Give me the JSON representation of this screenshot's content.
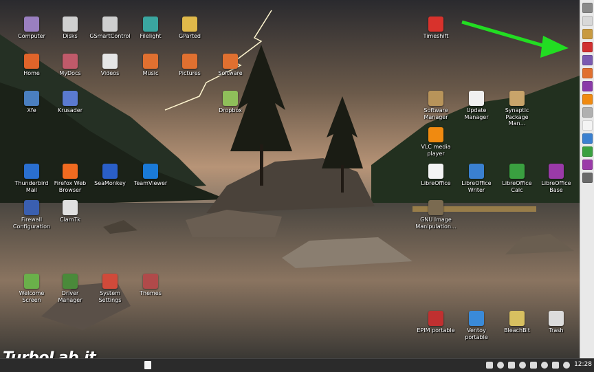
{
  "desktop_icons": [
    {
      "label": "Computer",
      "icon": "computer-icon",
      "color": "#9a7fc0"
    },
    {
      "label": "Disks",
      "icon": "disks-icon",
      "color": "#d0d0d0"
    },
    {
      "label": "GSmartControl",
      "icon": "gsmartcontrol-icon",
      "color": "#cfcfcf"
    },
    {
      "label": "Filelight",
      "icon": "filelight-icon",
      "color": "#3aa6a0"
    },
    {
      "label": "GParted",
      "icon": "gparted-icon",
      "color": "#e0b94a"
    },
    {
      "label": "Timeshift",
      "icon": "timeshift-icon",
      "color": "#d8322c"
    },
    {
      "label": "Home",
      "icon": "home-folder-icon",
      "color": "#e0642a"
    },
    {
      "label": "MyDocs",
      "icon": "mydocs-folder-icon",
      "color": "#c05a6a"
    },
    {
      "label": "Videos",
      "icon": "videos-folder-icon",
      "color": "#e6e6e6"
    },
    {
      "label": "Music",
      "icon": "music-folder-icon",
      "color": "#e07030"
    },
    {
      "label": "Pictures",
      "icon": "pictures-folder-icon",
      "color": "#e07030"
    },
    {
      "label": "Software",
      "icon": "software-folder-icon",
      "color": "#e07030"
    },
    {
      "label": "Xfe",
      "icon": "xfe-icon",
      "color": "#4a7fc0"
    },
    {
      "label": "Krusader",
      "icon": "krusader-icon",
      "color": "#5a7ad0"
    },
    {
      "label": "Dropbox",
      "icon": "dropbox-folder-icon",
      "color": "#8fbf5a"
    },
    {
      "label": "Software Manager",
      "icon": "software-manager-icon",
      "color": "#b8945a"
    },
    {
      "label": "Update Manager",
      "icon": "update-manager-icon",
      "color": "#f0f0f0"
    },
    {
      "label": "Synaptic Package Man...",
      "icon": "synaptic-icon",
      "color": "#c8a46a"
    },
    {
      "label": "VLC media player",
      "icon": "vlc-icon",
      "color": "#f08a10"
    },
    {
      "label": "Thunderbird Mail",
      "icon": "thunderbird-icon",
      "color": "#2a6fd0"
    },
    {
      "label": "Firefox Web Browser",
      "icon": "firefox-icon",
      "color": "#f06a20"
    },
    {
      "label": "SeaMonkey",
      "icon": "seamonkey-icon",
      "color": "#2a5fc8"
    },
    {
      "label": "TeamViewer",
      "icon": "teamviewer-icon",
      "color": "#1a7ad8"
    },
    {
      "label": "LibreOffice",
      "icon": "libreoffice-icon",
      "color": "#f4f4f4"
    },
    {
      "label": "LibreOffice Writer",
      "icon": "libreoffice-writer-icon",
      "color": "#3a80d0"
    },
    {
      "label": "LibreOffice Calc",
      "icon": "libreoffice-calc-icon",
      "color": "#3aa040"
    },
    {
      "label": "LibreOffice Base",
      "icon": "libreoffice-base-icon",
      "color": "#9a3aa8"
    },
    {
      "label": "Firewall Configuration",
      "icon": "firewall-icon",
      "color": "#3a5fb0"
    },
    {
      "label": "ClamTk",
      "icon": "clamtk-icon",
      "color": "#e0e0e0"
    },
    {
      "label": "GNU Image Manipulation...",
      "icon": "gimp-icon",
      "color": "#7a6a50"
    },
    {
      "label": "Welcome Screen",
      "icon": "welcome-screen-icon",
      "color": "#6ab04a"
    },
    {
      "label": "Driver Manager",
      "icon": "driver-manager-icon",
      "color": "#4a8a3a"
    },
    {
      "label": "System Settings",
      "icon": "system-settings-icon",
      "color": "#d04a3a"
    },
    {
      "label": "Themes",
      "icon": "themes-icon",
      "color": "#b04a4a"
    },
    {
      "label": "EPIM portable",
      "icon": "epim-icon",
      "color": "#c03030"
    },
    {
      "label": "Ventoy portable",
      "icon": "ventoy-icon",
      "color": "#3a8ad8"
    },
    {
      "label": "BleachBit",
      "icon": "bleachbit-icon",
      "color": "#d8c060"
    },
    {
      "label": "Trash",
      "icon": "trash-icon",
      "color": "#dcdcdc"
    }
  ],
  "side_panel": {
    "launchers": [
      {
        "icon": "panel-menu-icon",
        "color": "#8a8a8a"
      },
      {
        "icon": "panel-blank-icon",
        "color": "#d8d8d8"
      },
      {
        "icon": "panel-files-icon",
        "color": "#c89a40"
      },
      {
        "icon": "panel-record-icon",
        "color": "#d03030"
      },
      {
        "icon": "panel-media-icon",
        "color": "#7a5ab0"
      },
      {
        "icon": "panel-photos-icon",
        "color": "#e07030"
      },
      {
        "icon": "panel-purple-icon",
        "color": "#8a3aa8"
      },
      {
        "icon": "panel-vlc-icon",
        "color": "#f08a10"
      },
      {
        "icon": "panel-edit-icon",
        "color": "#b0b0b0"
      },
      {
        "icon": "panel-document-icon",
        "color": "#f4f4f4"
      },
      {
        "icon": "panel-writer-icon",
        "color": "#3a80d0"
      },
      {
        "icon": "panel-calc-icon",
        "color": "#3aa040"
      },
      {
        "icon": "panel-base-icon",
        "color": "#9a3aa8"
      },
      {
        "icon": "panel-gimp-icon",
        "color": "#6a6a6a"
      }
    ]
  },
  "arrow_color": "#22dd22",
  "taskbar": {
    "clock": "12:28",
    "tray_icons": [
      "folder-icon",
      "shield-icon",
      "dropbox-icon",
      "bluetooth-icon",
      "printer-icon",
      "network-icon",
      "volume-icon",
      "brightness-icon"
    ]
  },
  "watermark": {
    "name": "TurboLab",
    "dot": ".",
    "tld": "it"
  }
}
